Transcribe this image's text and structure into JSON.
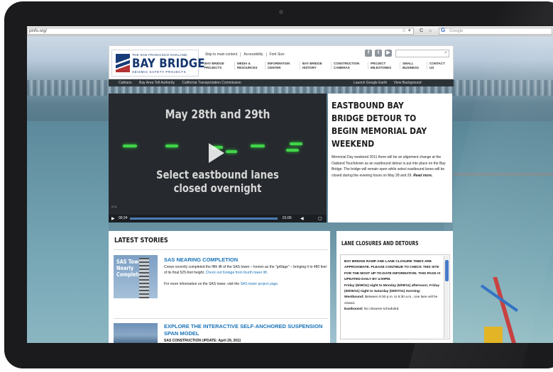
{
  "browser": {
    "url": "pinfo.org/",
    "search_placeholder": "Google",
    "buttons": [
      "☆",
      "▾",
      "C",
      "⌂",
      "Refresh",
      "Stop"
    ]
  },
  "header": {
    "logo_top": "THE SAN FRANCISCO-OAKLAND",
    "logo_main": "BAY BRIDGE",
    "logo_tag": "SEISMIC SAFETY PROJECTS",
    "util_links": [
      "Skip to main content",
      "Accessibility",
      "Font Size"
    ],
    "social_icons": [
      "f",
      "t",
      "▶"
    ],
    "search_icon": "search-icon",
    "nav": [
      [
        "BAY BRIDGE",
        "PROJECTS"
      ],
      [
        "MEDIA &",
        "RESOURCES"
      ],
      [
        "INFORMATION",
        "CENTER"
      ],
      [
        "BAY BRIDGE",
        "HISTORY"
      ],
      [
        "CONSTRUCTION",
        "CAMERAS"
      ],
      [
        "PROJECT",
        "MILESTONES"
      ],
      [
        "SMALL",
        "BUSINESS"
      ],
      [
        "CONTACT",
        "US"
      ]
    ]
  },
  "subbar": {
    "left": [
      "Caltrans",
      "Bay Area Toll Authority",
      "California Transportation Commission"
    ],
    "right": [
      "Launch Google Earth",
      "View Background"
    ]
  },
  "video": {
    "heading": "May 28th and 29th",
    "caption_line1": "Select eastbound lanes",
    "caption_line2": "closed overnight",
    "small_label": "0:01",
    "time_current": "00:24",
    "time_total": "01:00",
    "play_icon": "play-icon"
  },
  "feature": {
    "title": "EASTBOUND BAY BRIDGE DETOUR TO BEGIN MEMORIAL DAY WEEKEND",
    "body": "Memorial Day weekend 2011 there will be an alignment change at the Oakland Touchdown as an eastbound detour is put into place on the Bay Bridge.  The bridge will remain open while select eastbound lanes will be closed during the evening hours on May 28 and 29.",
    "read_more": "Read more."
  },
  "stories": {
    "heading": "LATEST STORIES",
    "items": [
      {
        "title": "SAS NEARING COMPLETION",
        "thumb_text": "SAS Tower Nearly Complete",
        "body": "Crews recently completed the fifth lift of the SAS tower – known as the \"grillage\" – bringing it to 480 feet of its final 525-foot height.",
        "link": "Check out footage from fourth tower lift.",
        "more_pre": "For more information on the SAS tower, visit the",
        "more_link": "SAS tower project page",
        "more_post": "."
      },
      {
        "title": "EXPLORE THE INTERACTIVE SELF-ANCHORED SUSPENSION SPAN MODEL",
        "body": "SAS CONSTRUCTION UPDATE: April 29, 2011"
      }
    ]
  },
  "closures": {
    "heading": "LANE CLOSURES AND DETOURS",
    "notice": "BAY BRIDGE RAMP AND LANE CLOSURE TIMES ARE APPROXIMATE. PLEASE CONTINUE TO CHECK THIS SITE FOR THE MOST UP-TO-DATE INFORMATION. THIS PAGE IS UPDATED DAILY BY 4:00PM.",
    "date": "Friday (5/06/11) night to Monday (5/09/11) afternoon; Friday (05/06/11) night to Saturday (05/07/11) morning:",
    "westbound_label": "Westbound:",
    "westbound": "Between 9:30 p.m. to 6:30 a.m., one lane will be closed.",
    "eastbound_label": "Eastbound:",
    "eastbound": "No closures scheduled."
  }
}
